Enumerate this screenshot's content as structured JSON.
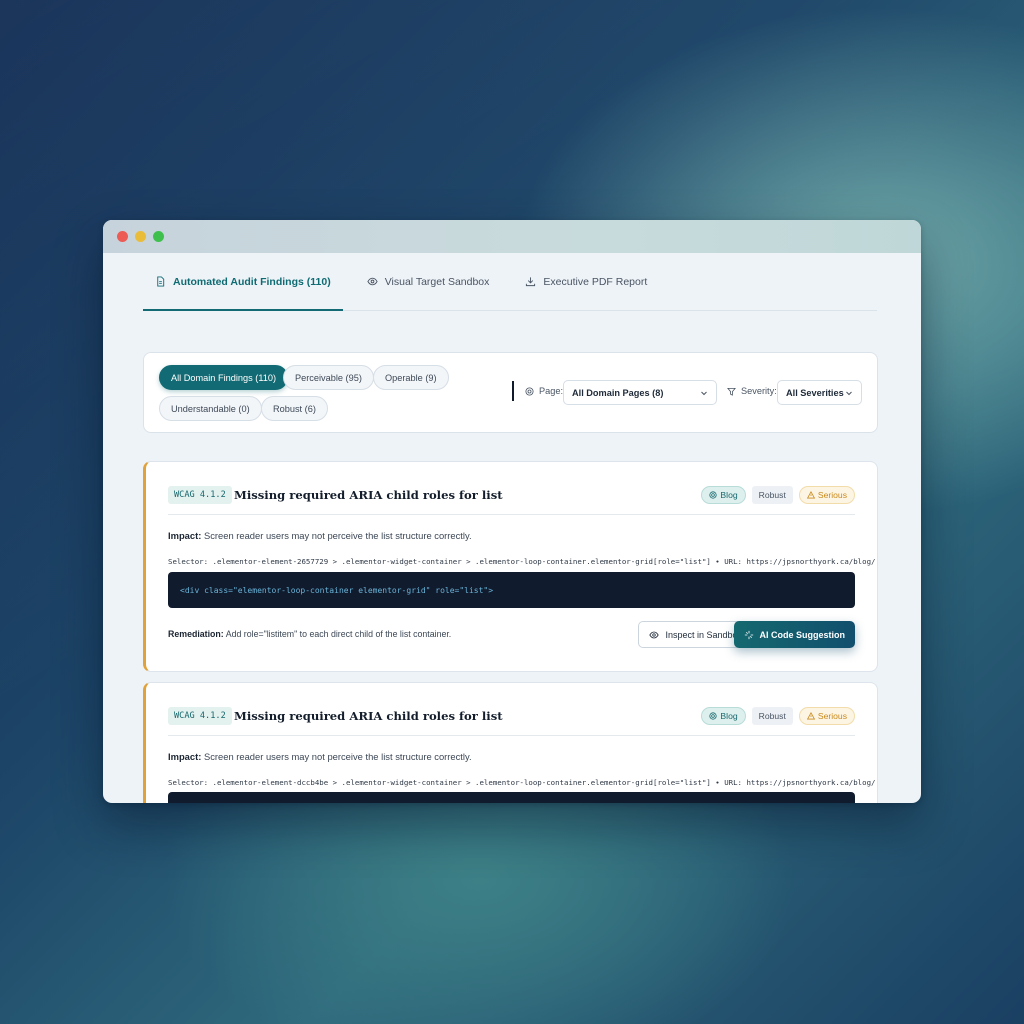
{
  "colors": {
    "accent": "#126b74",
    "severity": "#e2a23b",
    "code_bg": "#111b2e"
  },
  "tabs": [
    {
      "label": "Automated Audit Findings (110)",
      "icon": "document-icon",
      "active": true
    },
    {
      "label": "Visual Target Sandbox",
      "icon": "eye-icon",
      "active": false
    },
    {
      "label": "Executive PDF Report",
      "icon": "download-icon",
      "active": false
    }
  ],
  "filters": {
    "pills": [
      {
        "label": "All Domain Findings (110)",
        "active": true
      },
      {
        "label": "Perceivable (95)",
        "active": false
      },
      {
        "label": "Operable (9)",
        "active": false
      },
      {
        "label": "Understandable (0)",
        "active": false
      },
      {
        "label": "Robust (6)",
        "active": false
      }
    ],
    "page_label": "Page:",
    "page_value": "All Domain Pages (8)",
    "severity_label": "Severity:",
    "severity_value": "All Severities"
  },
  "findings": [
    {
      "wcag": "WCAG 4.1.2",
      "title": "Missing required ARIA child roles for list",
      "tag": "Blog",
      "category": "Robust",
      "severity": "Serious",
      "impact_label": "Impact:",
      "impact": "Screen reader users may not perceive the list structure correctly.",
      "selector": "Selector: .elementor-element-2657729 > .elementor-widget-container > .elementor-loop-container.elementor-grid[role=\"list\"] • URL: https://jpsnorthyork.ca/blog/",
      "code": "<div class=\"elementor-loop-container elementor-grid\" role=\"list\">",
      "remediation_label": "Remediation:",
      "remediation": "Add role=\"listitem\" to each direct child of the list container.",
      "inspect_label": "Inspect in Sandbox",
      "ai_label": "AI Code Suggestion"
    },
    {
      "wcag": "WCAG 4.1.2",
      "title": "Missing required ARIA child roles for list",
      "tag": "Blog",
      "category": "Robust",
      "severity": "Serious",
      "impact_label": "Impact:",
      "impact": "Screen reader users may not perceive the list structure correctly.",
      "selector": "Selector: .elementor-element-dccb4be > .elementor-widget-container > .elementor-loop-container.elementor-grid[role=\"list\"] • URL: https://jpsnorthyork.ca/blog/"
    }
  ]
}
